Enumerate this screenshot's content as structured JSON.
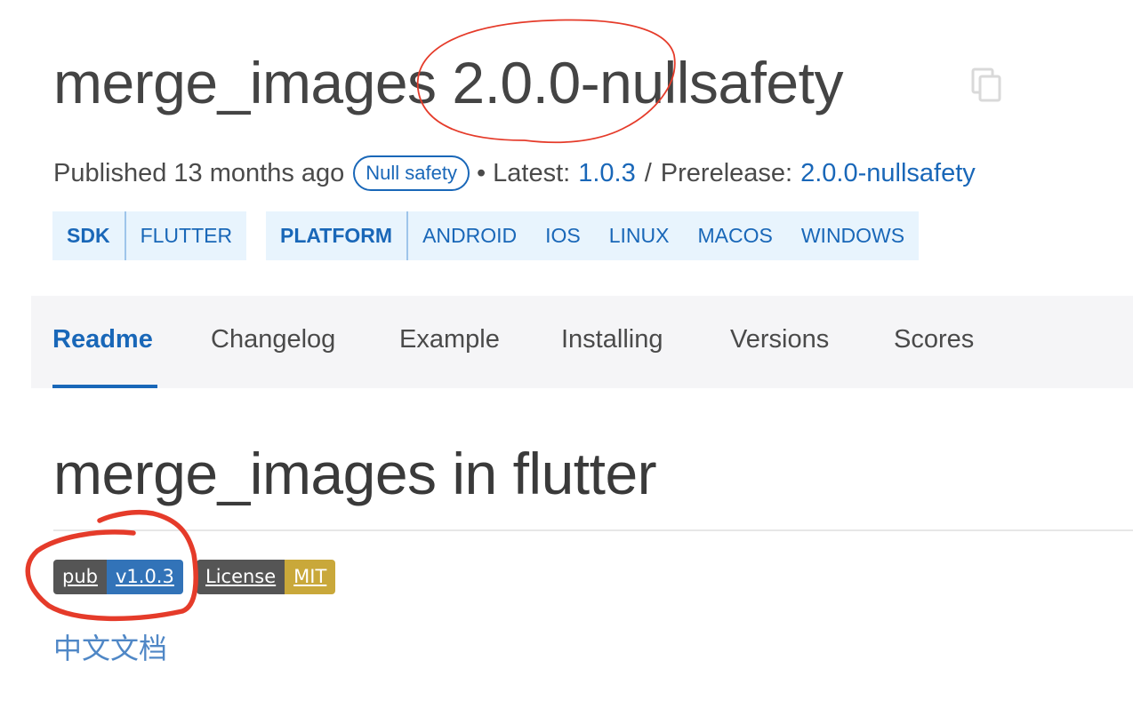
{
  "package": {
    "title": "merge_images 2.0.0-nullsafety"
  },
  "meta": {
    "published_text": "Published 13 months ago",
    "null_safety_badge": "Null safety",
    "separator": "•",
    "latest_label": "Latest:",
    "latest_version": "1.0.3",
    "slash": "/",
    "prerelease_label": "Prerelease:",
    "prerelease_version": "2.0.0-nullsafety"
  },
  "sdk_tags": {
    "label": "SDK",
    "values": [
      "FLUTTER"
    ]
  },
  "platform_tags": {
    "label": "PLATFORM",
    "values": [
      "ANDROID",
      "IOS",
      "LINUX",
      "MACOS",
      "WINDOWS"
    ]
  },
  "tabs": [
    {
      "label": "Readme",
      "active": true
    },
    {
      "label": "Changelog",
      "active": false
    },
    {
      "label": "Example",
      "active": false
    },
    {
      "label": "Installing",
      "active": false
    },
    {
      "label": "Versions",
      "active": false
    },
    {
      "label": "Scores",
      "active": false
    }
  ],
  "readme": {
    "title": "merge_images in flutter",
    "badges": [
      {
        "label": "pub",
        "value": "v1.0.3",
        "color": "#3273b8"
      },
      {
        "label": "License",
        "value": "MIT",
        "color": "#c9a83a"
      }
    ],
    "chinese_doc_link": "中文文档"
  },
  "colors": {
    "accent": "#1967b8",
    "annotation": "#e53b2a"
  },
  "icons": {
    "copy": "copy-icon"
  }
}
